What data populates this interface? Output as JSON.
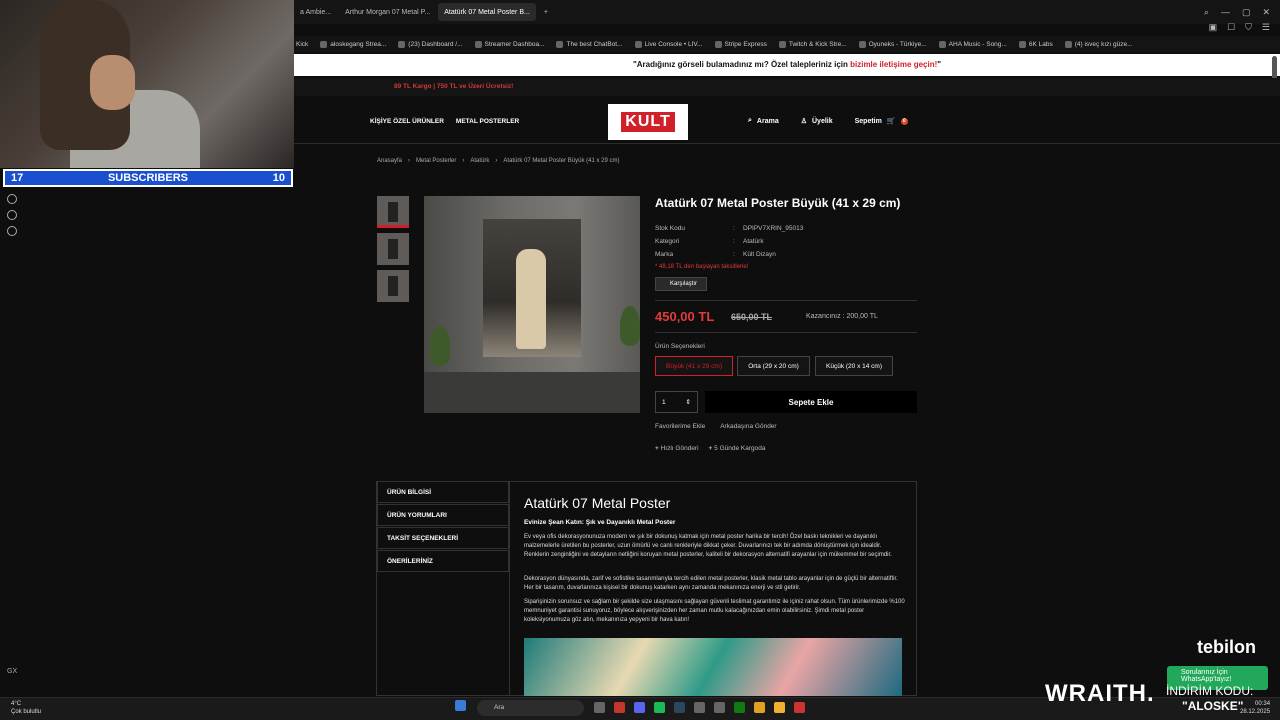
{
  "browser": {
    "tabs": [
      {
        "label": "a Ambie..."
      },
      {
        "label": "Arthur Morgan 07 Metal P..."
      },
      {
        "label": "Atatürk 07 Metal Poster B..."
      }
    ],
    "bookmarks": [
      "Kick",
      "aloskegang Strea...",
      "(23) Dashboard /...",
      "Streamer Dashboa...",
      "The best ChatBot...",
      "Live Console • LIV...",
      "Stripe Express",
      "Twitch & Kick Stre...",
      "Oyuneks - Türkiye...",
      "AHA Music - Song...",
      "6K Labs",
      "(4) isveç kızı güze..."
    ]
  },
  "overlay": {
    "subs_left": "17",
    "subs_title": "SUBSCRIBERS",
    "subs_right": "10",
    "gx": "GX"
  },
  "site": {
    "promo_pre": "\"Aradığınız görseli bulamadınız mı? Özel talepleriniz için ",
    "promo_link": "bizimle iletişime geçin!",
    "promo_post": "\"",
    "shipping": "89 TL Kargo | 750 TL ve Üzeri Ücretsiz!",
    "nav_left": [
      "KİŞİYE ÖZEL ÜRÜNLER",
      "METAL POSTERLER"
    ],
    "logo": "KULT",
    "nav_search": "Arama",
    "nav_account": "Üyelik",
    "nav_cart": "Sepetim",
    "cart_count": "0",
    "breadcrumb": [
      "Anasayfa",
      "Metal Posterler",
      "Atatürk",
      "Atatürk 07 Metal Poster Büyük (41 x 29 cm)"
    ]
  },
  "product": {
    "title": "Atatürk 07 Metal Poster Büyük (41 x 29 cm)",
    "specs": [
      {
        "k": "Stok Kodu",
        "v": "DPIPV7XRIN_95013"
      },
      {
        "k": "Kategori",
        "v": "Atatürk"
      },
      {
        "k": "Marka",
        "v": "Kült Dizayn"
      }
    ],
    "installment": "* 48,18 TL den başlayan taksitlerle!",
    "compare": "Karşılaştır",
    "price": "450,00 TL",
    "old_price": "650,00 TL",
    "saving": "Kazancınız : 200,00 TL",
    "options_label": "Ürün Seçenekleri",
    "options": [
      "Büyük (41 x 29 cm)",
      "Orta (29 x 20 cm)",
      "Küçük (20 x 14 cm)"
    ],
    "qty": "1",
    "add_to_cart": "Sepete Ekle",
    "fav": "Favorilerime Ekle",
    "share": "Arkadaşına Gönder",
    "fast": "Hızlı Gönderi",
    "cargo": "5 Günde Kargoda"
  },
  "details": {
    "tabs": [
      "ÜRÜN BİLGİSİ",
      "ÜRÜN YORUMLARI",
      "TAKSİT SEÇENEKLERİ",
      "ÖNERİLERİNİZ"
    ],
    "title": "Atatürk 07 Metal Poster",
    "subtitle": "Evinize Şean Katın: Şık ve Dayanıklı Metal Poster",
    "p1": "Ev veya ofis dekorasyonunuza modern ve şık bir dokunuş katmak için metal poster harika bir tercih! Özel baskı teknikleri ve dayanıklı malzemelerle üretilen bu posterler, uzun ömürlü ve canlı renkleriyle dikkat çeker. Duvarlarınızı tek bir adımda dönüştürmek için idealdir. Renklerin zenginliğini ve detayların netliğini koruyan metal posterler, kaliteli bir dekorasyon alternatifi arayanlar için mükemmel bir seçimdir.",
    "p2": "Dekorasyon dünyasında, zarif ve sofistike tasarımlarıyla tercih edilen metal posterler, klasik metal tablo arayanlar için de güçlü bir alternatiftir. Her bir tasarım, duvarlarınıza kişisel bir dokunuş katarken aynı zamanda mekanınıza enerji ve stil getirir.",
    "p3": "Siparişinizin sorunsuz ve sağlam bir şekilde size ulaşmasını sağlayan güvenli teslimat garantimiz ile içiniz rahat olsun. Tüm ürünlerimizde %100 memnuniyet garantisi sunuyoruz, böylece alışverişinizden her zaman mutlu kalacağınızdan emin olabilirsiniz. Şimdi metal poster koleksiyonumuza göz atın, mekanınıza yepyeni bir hava katın!"
  },
  "stream": {
    "tebilon": "tebilon",
    "wa": "Sorularınız İçin WhatsApp'tayız!",
    "wraith": "WRAITH.",
    "indirim": "İNDİRİM KODU:",
    "kod": "\"ALOSKE\""
  },
  "taskbar": {
    "temp": "4°C",
    "weather": "Çok bulutlu",
    "search": "Ara",
    "time": "00:34",
    "date": "28.12.2025"
  },
  "colors": {
    "accent": "#d21f2a",
    "subbar": "#1a4fd0",
    "whatsapp": "#22a85a"
  }
}
